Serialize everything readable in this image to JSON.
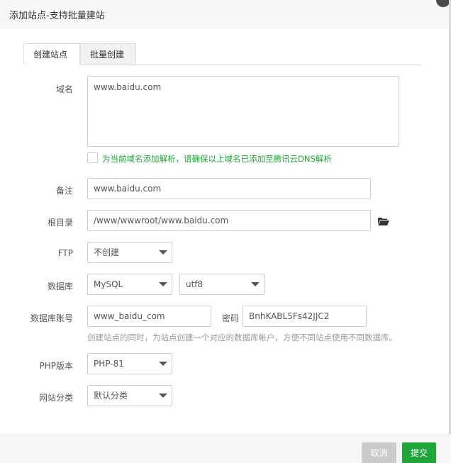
{
  "dialog": {
    "title": "添加站点-支持批量建站"
  },
  "tabs": [
    {
      "label": "创建站点",
      "active": true
    },
    {
      "label": "批量创建",
      "active": false
    }
  ],
  "form": {
    "domain": {
      "label": "域名",
      "value": "www.baidu.com"
    },
    "dns_checkbox": {
      "label": "为当前域名添加解析，请确保以上域名已添加至腾讯云DNS解析",
      "checked": false
    },
    "remark": {
      "label": "备注",
      "value": "www.baidu.com"
    },
    "root_dir": {
      "label": "根目录",
      "value": "/www/wwwroot/www.baidu.com"
    },
    "ftp": {
      "label": "FTP",
      "selected": "不创建"
    },
    "database": {
      "label": "数据库",
      "type_selected": "MySQL",
      "charset_selected": "utf8"
    },
    "db_account": {
      "label": "数据库账号",
      "value": "www_baidu_com",
      "password_label": "密码",
      "password_value": "BnhKABL5Fs42JJC2"
    },
    "db_hint": "创建站点的同时，为站点创建一个对应的数据库帐户，方便不同站点使用不同数据库。",
    "php_version": {
      "label": "PHP版本",
      "selected": "PHP-81"
    },
    "site_category": {
      "label": "网站分类",
      "selected": "默认分类"
    }
  },
  "footer": {
    "cancel_label": "取消",
    "submit_label": "提交"
  },
  "colors": {
    "accent": "#20a53a",
    "cancel": "#cbcbcb"
  }
}
